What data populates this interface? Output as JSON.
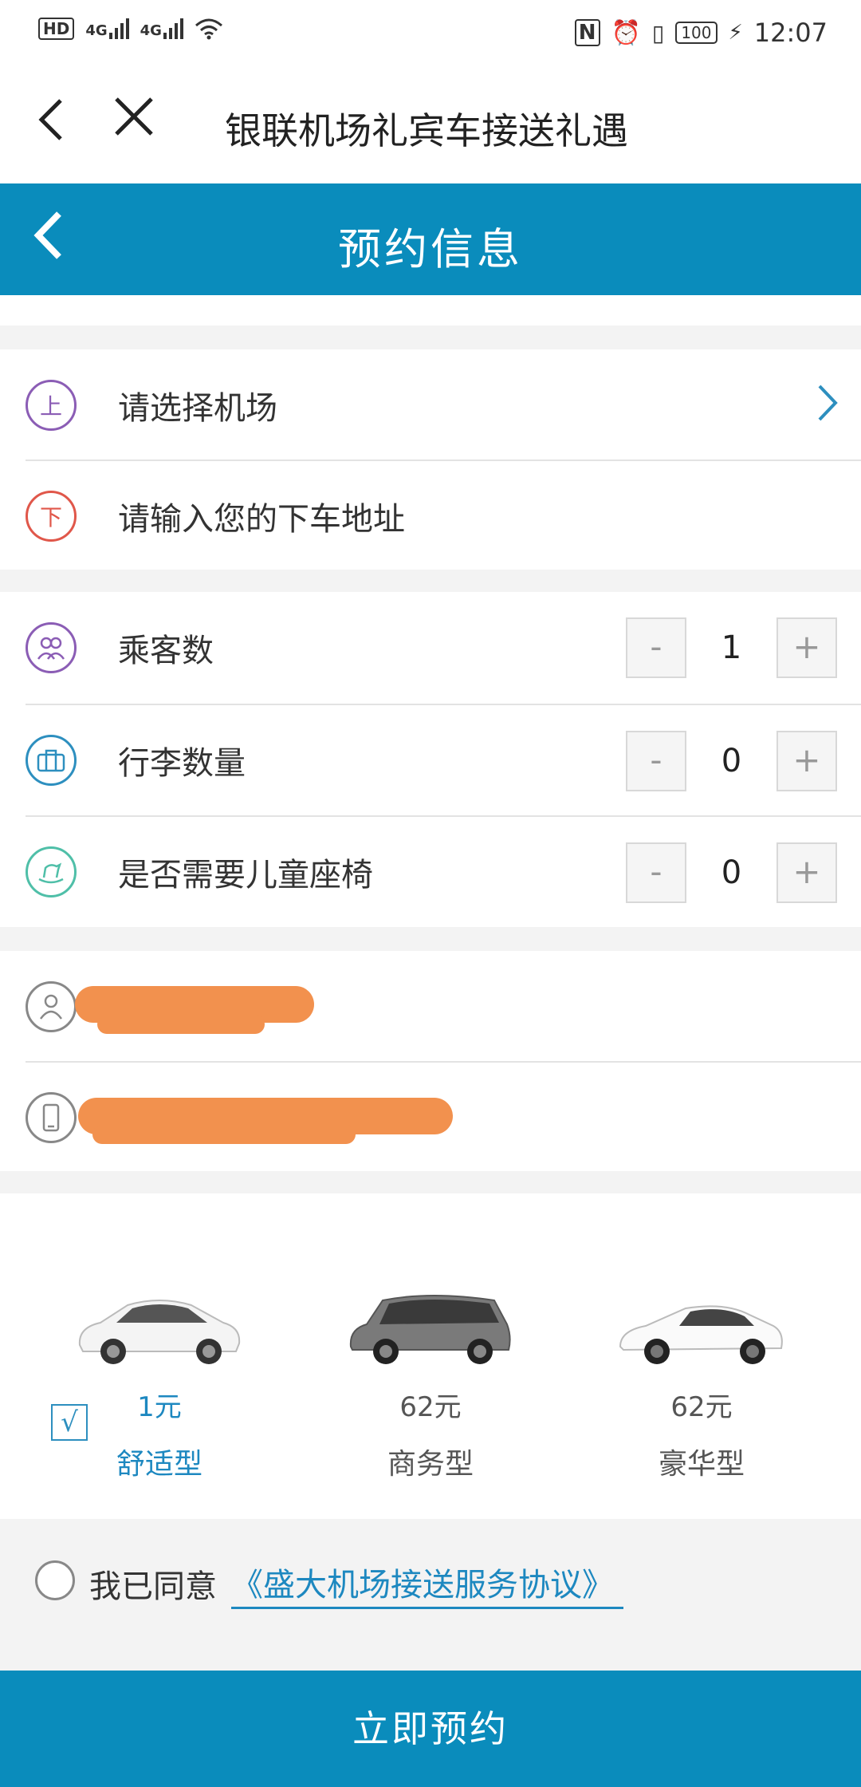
{
  "status_bar": {
    "hd": "HD",
    "sim1": "4G",
    "sim2": "4G",
    "battery": "100",
    "time": "12:07",
    "icons": [
      "nfc-icon",
      "alarm-icon",
      "vibrate-icon",
      "charging-icon",
      "wifi-icon"
    ]
  },
  "browser": {
    "title": "银联机场礼宾车接送礼遇"
  },
  "header": {
    "title": "预约信息"
  },
  "location": {
    "pickup_badge": "上",
    "pickup_label": "请选择机场",
    "dropoff_badge": "下",
    "dropoff_label": "请输入您的下车地址"
  },
  "counts": [
    {
      "label": "乘客数",
      "value": "1",
      "icon": "passengers-icon"
    },
    {
      "label": "行李数量",
      "value": "0",
      "icon": "luggage-icon"
    },
    {
      "label": "是否需要儿童座椅",
      "value": "0",
      "icon": "child-seat-icon"
    }
  ],
  "stepper": {
    "minus": "-",
    "plus": "+"
  },
  "contact": {
    "name_icon": "person-icon",
    "phone_icon": "phone-icon"
  },
  "cars": [
    {
      "price": "1元",
      "type": "舒适型",
      "selected": true
    },
    {
      "price": "62元",
      "type": "商务型",
      "selected": false
    },
    {
      "price": "62元",
      "type": "豪华型",
      "selected": false
    }
  ],
  "checkbox_mark": "√",
  "agreement": {
    "prefix": "我已同意",
    "link": "《盛大机场接送服务协议》"
  },
  "submit": "立即预约",
  "colors": {
    "brand": "#0a8cbc",
    "link": "#1d88c0",
    "redaction": "#f2914e"
  }
}
